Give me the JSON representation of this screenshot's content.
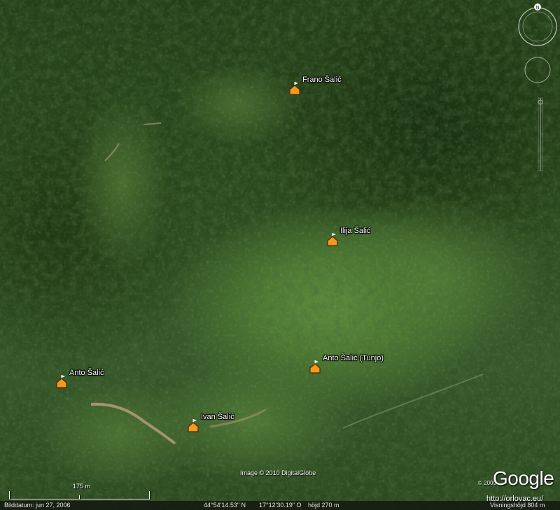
{
  "markers": [
    {
      "label": "Frano Šalić"
    },
    {
      "label": "Ilija Šalić"
    },
    {
      "label": "Anto Šalić (Tunjo)"
    },
    {
      "label": "Anto Šalić"
    },
    {
      "label": "Ivan Šalić"
    }
  ],
  "imagery_credit": "Image © 2010 DigitalGlobe",
  "copyright_year": "© 2009",
  "logo_text": "Google",
  "watermark_url": "http://orlovac.eu/",
  "scale_bar": {
    "label": "175 m"
  },
  "status": {
    "image_date": "Bilddatum: jun 27, 2006",
    "latitude": "44°54'14.53\" N",
    "longitude": "17°12'30.19\" O",
    "elevation": "höjd  270 m",
    "eye_altitude": "Visningshöjd   804 m"
  },
  "navigation": {
    "north_label": "N"
  },
  "colors": {
    "marker_fill": "#f39a1e",
    "marker_stroke": "#4a2a00",
    "forest": "#24401a",
    "meadow": "#5d8a3c",
    "road": "#b99a7a"
  },
  "icons": [
    "placemark-house-icon",
    "flag-icon",
    "compass-icon",
    "look-joystick-icon",
    "move-joystick-icon",
    "zoom-slider-icon"
  ]
}
